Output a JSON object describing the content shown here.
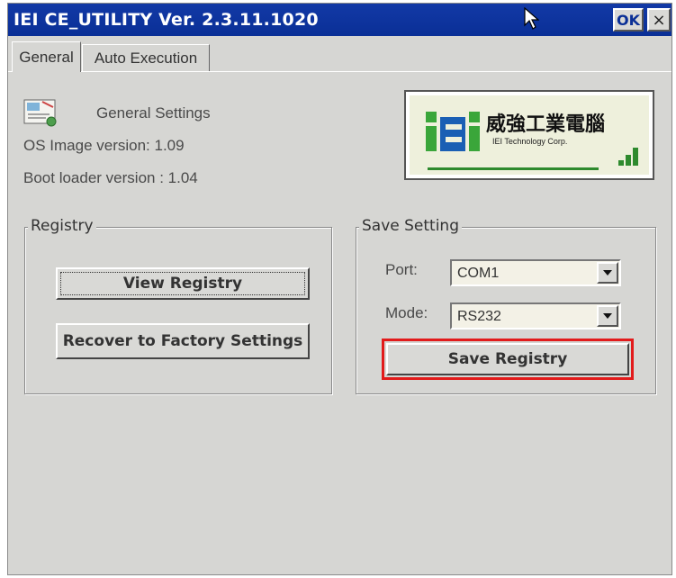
{
  "window": {
    "title": "IEI CE_UTILITY Ver. 2.3.11.1020",
    "ok_label": "OK",
    "close_label": "×"
  },
  "tabs": [
    {
      "label": "General",
      "active": true
    },
    {
      "label": "Auto Execution",
      "active": false
    }
  ],
  "general": {
    "heading": "General Settings",
    "os_image": "OS Image version: 1.09",
    "boot_loader": "Boot loader version : 1.04"
  },
  "logo": {
    "cjk_text": "威強工業電腦",
    "sub_text": "IEI Technology Corp.",
    "brand_colors": {
      "green": "#3aa63a",
      "blue": "#1a5fb4"
    }
  },
  "registry": {
    "legend": "Registry",
    "view_button": "View Registry",
    "recover_button": "Recover to Factory Settings"
  },
  "save_setting": {
    "legend": "Save Setting",
    "port_label": "Port:",
    "port_value": "COM1",
    "mode_label": "Mode:",
    "mode_value": "RS232",
    "save_button": "Save Registry",
    "highlight_color": "#e21b1b"
  },
  "icons": {
    "title_cursor": "mouse-pointer-icon",
    "settings": "general-settings-icon",
    "dropdown": "chevron-down-icon"
  }
}
